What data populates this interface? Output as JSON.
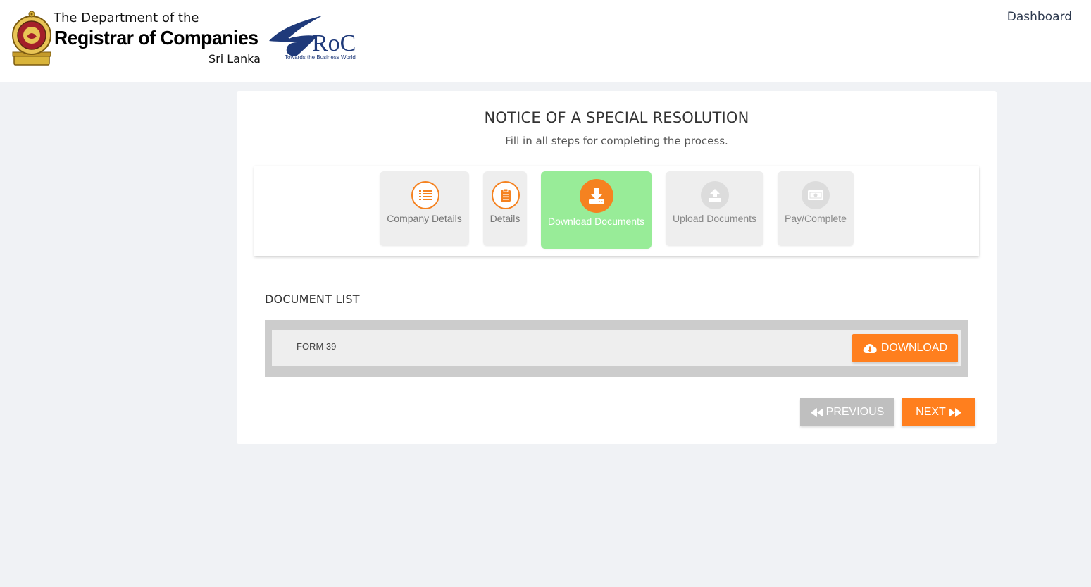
{
  "header": {
    "brand_line1": "The Department of the",
    "brand_line2": "Registrar of Companies",
    "brand_line3": "Sri Lanka",
    "eroc_text": "RoC",
    "eroc_tagline": "Towards the Business World",
    "nav_dashboard": "Dashboard"
  },
  "page": {
    "title": "NOTICE OF A SPECIAL RESOLUTION",
    "subtitle": "Fill in all steps for completing the process."
  },
  "stepper": {
    "steps": [
      {
        "label": "Company Details",
        "icon": "list-icon",
        "state": "done"
      },
      {
        "label": "Details",
        "icon": "clipboard-icon",
        "state": "done"
      },
      {
        "label": "Download Documents",
        "icon": "download-icon",
        "state": "active"
      },
      {
        "label": "Upload Documents",
        "icon": "upload-icon",
        "state": "disabled"
      },
      {
        "label": "Pay/Complete",
        "icon": "money-icon",
        "state": "disabled"
      }
    ]
  },
  "documents": {
    "heading": "DOCUMENT LIST",
    "items": [
      {
        "name": "FORM 39",
        "action_label": "DOWNLOAD"
      }
    ]
  },
  "navigation": {
    "previous_label": "PREVIOUS",
    "next_label": "NEXT"
  },
  "colors": {
    "accent": "#ff7f1e",
    "active_step": "#98ec98",
    "disabled_button": "#bfbfbf",
    "brand_blue": "#1f3a7a"
  }
}
